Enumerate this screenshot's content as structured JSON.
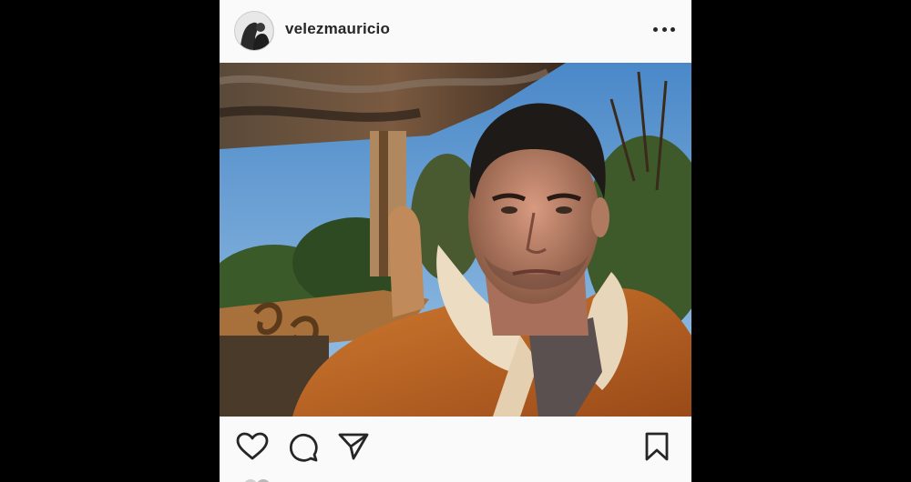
{
  "post": {
    "username": "velezmauricio",
    "avatar_icon": "profile-avatar-icon",
    "more_icon": "more-options-icon",
    "photo_alt": "",
    "actions": {
      "like_icon": "heart-icon",
      "comment_icon": "comment-bubble-icon",
      "share_icon": "paper-plane-icon",
      "save_icon": "bookmark-icon"
    }
  },
  "colors": {
    "post_background": "#fafafa",
    "text_primary": "#262626",
    "page_background": "#000000"
  }
}
